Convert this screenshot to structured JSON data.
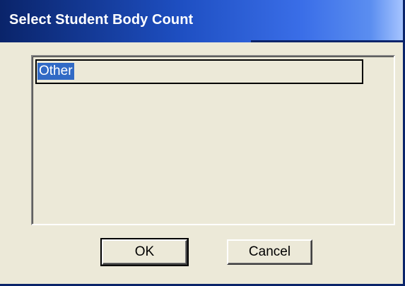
{
  "dialog": {
    "title": "Select Student Body Count"
  },
  "list": {
    "items": [
      {
        "label": "Other",
        "selected": true
      }
    ]
  },
  "buttons": {
    "ok_label": "OK",
    "cancel_label": "Cancel"
  },
  "colors": {
    "titlebar_start": "#0a246a",
    "titlebar_end": "#a6c4ff",
    "selection": "#316ac5",
    "dialog_face": "#ece9d8"
  }
}
